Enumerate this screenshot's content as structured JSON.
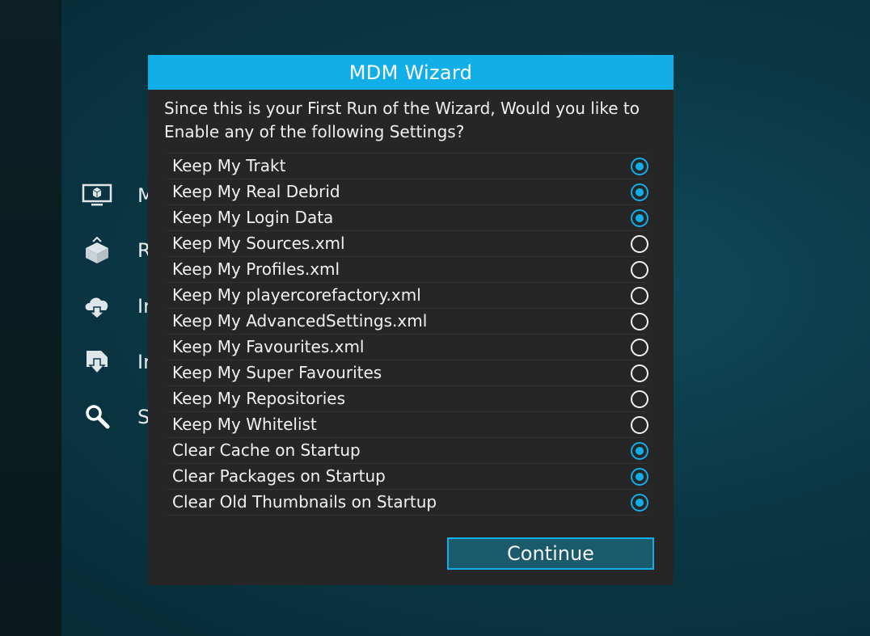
{
  "background_menu": {
    "items": [
      {
        "icon": "monitor-box-icon",
        "label": "M"
      },
      {
        "icon": "boxes-stack-icon",
        "label": "R"
      },
      {
        "icon": "cloud-download-icon",
        "label": "In"
      },
      {
        "icon": "box-download-icon",
        "label": "In"
      },
      {
        "icon": "search-icon",
        "label": "S"
      }
    ]
  },
  "dialog": {
    "title": "MDM Wizard",
    "message": "Since this is your First Run of the Wizard, Would you like to Enable any of the following Settings?",
    "options": [
      {
        "label": "Keep My Trakt",
        "checked": true
      },
      {
        "label": "Keep My Real Debrid",
        "checked": true
      },
      {
        "label": "Keep My Login Data",
        "checked": true
      },
      {
        "label": "Keep My Sources.xml",
        "checked": false
      },
      {
        "label": "Keep My Profiles.xml",
        "checked": false
      },
      {
        "label": "Keep My playercorefactory.xml",
        "checked": false
      },
      {
        "label": "Keep My AdvancedSettings.xml",
        "checked": false
      },
      {
        "label": "Keep My Favourites.xml",
        "checked": false
      },
      {
        "label": "Keep My Super Favourites",
        "checked": false
      },
      {
        "label": "Keep My Repositories",
        "checked": false
      },
      {
        "label": "Keep My Whitelist",
        "checked": false
      },
      {
        "label": "Clear Cache on Startup",
        "checked": true
      },
      {
        "label": "Clear Packages on Startup",
        "checked": true
      },
      {
        "label": "Clear Old Thumbnails on Startup",
        "checked": true
      }
    ],
    "continue_label": "Continue"
  },
  "colors": {
    "accent": "#12aee8",
    "dialog_bg": "#262626",
    "button_bg": "#1a5a6b"
  }
}
